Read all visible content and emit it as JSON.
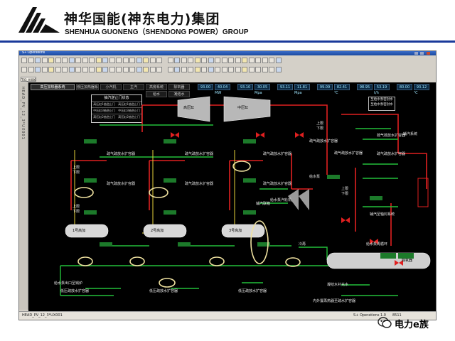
{
  "brand": {
    "name_cn": "神华国能(神东电力)集团",
    "name_en": "SHENHUA GUONENG（SHENDONG POWER）GROUP",
    "accent_color": "#1a3a9a"
  },
  "window": {
    "title": "S+ Operations",
    "doc_tab": "T03_HXB6"
  },
  "dcs": {
    "header_tabs": [
      "高压加热器系统",
      "低压加热器系统",
      "小汽机",
      "主汽",
      "高旁系统",
      "除氧器",
      "凝结水",
      "给水"
    ],
    "header_readouts": [
      "93.00",
      "40.04",
      "93.10",
      "30.05",
      "93.11",
      "11.81",
      "99.09",
      "82.41",
      "98.95",
      "53.19",
      "80.00",
      "93.12"
    ],
    "header_units": [
      "MW",
      "Mpa",
      "Mpa",
      "℃",
      "t/h",
      "℃"
    ],
    "panel": {
      "title": "抽汽逆止门状态",
      "rows": [
        [
          "高压缸1抽逆止门",
          "高压缸1抽逆止门"
        ],
        [
          "中压缸3抽逆止门",
          "中压缸3抽逆止门"
        ],
        [
          "高压缸2抽逆止门",
          "高压缸2抽逆止门"
        ]
      ]
    },
    "turbines": [
      "高压缸",
      "中压缸"
    ],
    "small_turbine": "给水泵汽轮机",
    "heaters": [
      "1号高加",
      "2号高加",
      "3号高加"
    ],
    "deaerator": "除氧器",
    "labels": {
      "drain_valve": "疏气疏放水扩容器",
      "upper": "上限",
      "lower": "下限",
      "steam_system": "辅汽系统",
      "low_pressure_drain": "低压疏放水扩容器",
      "aux_steam": "辅汽联箱",
      "gland_steam": "辅汽至轴封系统",
      "pump_outlet": "给水泵出口至锅炉",
      "feedwater_side": "给水泵",
      "cold_reheat": "冷再",
      "makeup": "内外置再热器至疏水扩容器",
      "fill": "凝结水补充水",
      "water_recirc": "给水泵再循环",
      "note": [
        "至给水泵密封水",
        "至给水泵密封水"
      ]
    }
  },
  "status_bar": {
    "left": "HEAD_PV_12_3*UX001",
    "right": "S+ Operations 1.0",
    "time": "8511"
  },
  "watermark": {
    "text": "电力e族"
  }
}
